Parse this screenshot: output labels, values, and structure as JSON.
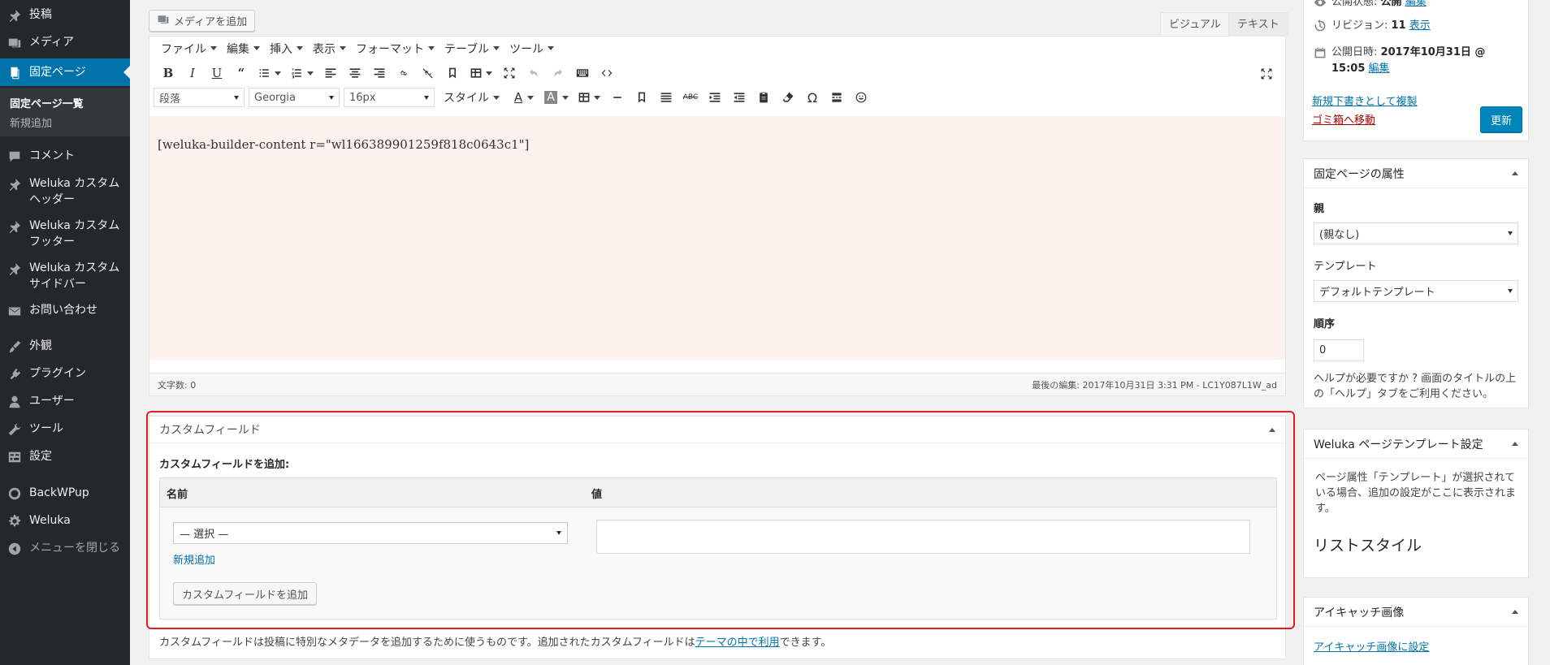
{
  "sidebar": {
    "items": [
      {
        "label": "投稿",
        "icon": "pin-icon"
      },
      {
        "label": "メディア",
        "icon": "media-icon"
      },
      {
        "label": "固定ページ",
        "icon": "pages-icon"
      },
      {
        "label": "コメント",
        "icon": "comment-icon"
      },
      {
        "label": "Weluka カスタムヘッダー",
        "icon": "pin-icon"
      },
      {
        "label": "Weluka カスタムフッター",
        "icon": "pin-icon"
      },
      {
        "label": "Weluka カスタムサイドバー",
        "icon": "pin-icon"
      },
      {
        "label": "お問い合わせ",
        "icon": "mail-icon"
      },
      {
        "label": "外観",
        "icon": "brush-icon"
      },
      {
        "label": "プラグイン",
        "icon": "plugin-icon"
      },
      {
        "label": "ユーザー",
        "icon": "user-icon"
      },
      {
        "label": "ツール",
        "icon": "wrench-icon"
      },
      {
        "label": "設定",
        "icon": "settings-icon"
      },
      {
        "label": "BackWPup",
        "icon": "backwpup-icon"
      },
      {
        "label": "Weluka",
        "icon": "gear-icon"
      },
      {
        "label": "メニューを閉じる",
        "icon": "collapse-icon"
      }
    ],
    "submenu": {
      "current": "固定ページ一覧",
      "add_new": "新規追加"
    }
  },
  "editor": {
    "add_media": "メディアを追加",
    "tab_visual": "ビジュアル",
    "tab_text": "テキスト",
    "menubar": [
      "ファイル",
      "編集",
      "挿入",
      "表示",
      "フォーマット",
      "テーブル",
      "ツール"
    ],
    "format_select": "段落",
    "font_select": "Georgia",
    "size_select": "16px",
    "style_label": "スタイル",
    "content": "[weluka-builder-content r=\"wl166389901259f818c0643c1\"]",
    "word_count": "文字数: 0",
    "last_edited": "最後の編集: 2017年10月31日 3:31 PM - LC1Y087L1W_ad"
  },
  "custom_fields": {
    "title": "カスタムフィールド",
    "add_title": "カスタムフィールドを追加:",
    "col_name": "名前",
    "col_value": "値",
    "select_placeholder": "— 選択 —",
    "new_link": "新規追加",
    "add_button": "カスタムフィールドを追加",
    "desc_before": "カスタムフィールドは投稿に特別なメタデータを追加するために使うものです。追加されたカスタムフィールドは",
    "desc_link": "テーマの中で利用",
    "desc_after": "できます。"
  },
  "publish": {
    "status_label": "公開状態:",
    "status_value": "公開",
    "status_edit": "編集",
    "revision_label": "リビジョン:",
    "revision_value": "11",
    "revision_link": "表示",
    "date_label": "公開日時:",
    "date_value": "2017年10月31日 @ 15:05",
    "date_edit": "編集",
    "copy_link": "新規下書きとして複製",
    "trash_link": "ゴミ箱へ移動",
    "update_button": "更新"
  },
  "page_attributes": {
    "title": "固定ページの属性",
    "parent_label": "親",
    "parent_value": "(親なし)",
    "template_label": "テンプレート",
    "template_value": "デフォルトテンプレート",
    "order_label": "順序",
    "order_value": "0",
    "help": "ヘルプが必要ですか ? 画面のタイトルの上の「ヘルプ」タブをご利用ください。"
  },
  "weluka_template": {
    "title": "Weluka ページテンプレート設定",
    "desc": "ページ属性「テンプレート」が選択されている場合、追加の設定がここに表示されます。",
    "list_style": "リストスタイル"
  },
  "featured_image": {
    "title": "アイキャッチ画像",
    "set_link": "アイキャッチ画像に設定"
  },
  "colors": {
    "sidebar_bg": "#23282d",
    "accent": "#0073aa",
    "highlight": "#e02020",
    "trash": "#a00"
  }
}
